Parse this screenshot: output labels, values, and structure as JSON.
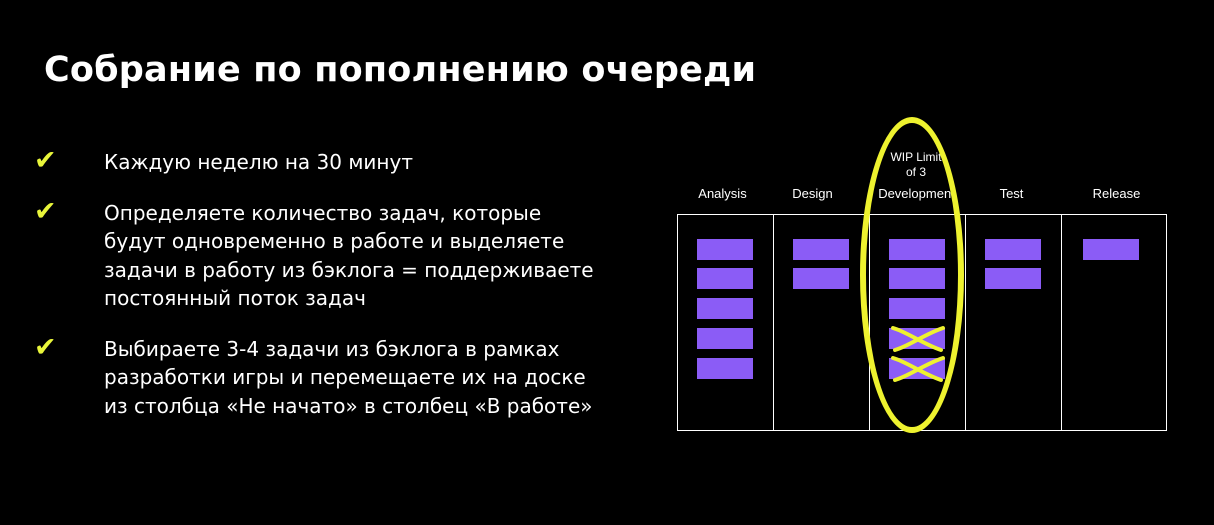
{
  "slide": {
    "title": "Собрание по пополнению очереди",
    "bullets": [
      {
        "icon": "check-icon",
        "text": "Каждую неделю на 30 минут"
      },
      {
        "icon": "check-icon",
        "text": "Определяете количество задач, которые\nбудут одновременно в работе и выделяете\nзадачи в работу из бэклога = поддерживаете\nпостоянный поток задач"
      },
      {
        "icon": "check-icon",
        "text": "Выбираете 3-4 задачи из бэклога в рамках\nразработки игры и перемещаете их на доске\nиз столбца «Не начато» в столбец «В работе»"
      }
    ]
  },
  "board": {
    "wip_label": "WIP Limit\nof 3",
    "columns": [
      {
        "name": "Analysis",
        "cards": 5,
        "crossed": 0
      },
      {
        "name": "Design",
        "cards": 2,
        "crossed": 0
      },
      {
        "name": "Development",
        "cards": 5,
        "crossed": 2
      },
      {
        "name": "Test",
        "cards": 2,
        "crossed": 0
      },
      {
        "name": "Release",
        "cards": 1,
        "crossed": 0
      }
    ],
    "colors": {
      "card": "#8b5cf6",
      "highlight": "#eef22f",
      "check": "#e8f53a",
      "background": "#000000",
      "text": "#ffffff"
    }
  }
}
